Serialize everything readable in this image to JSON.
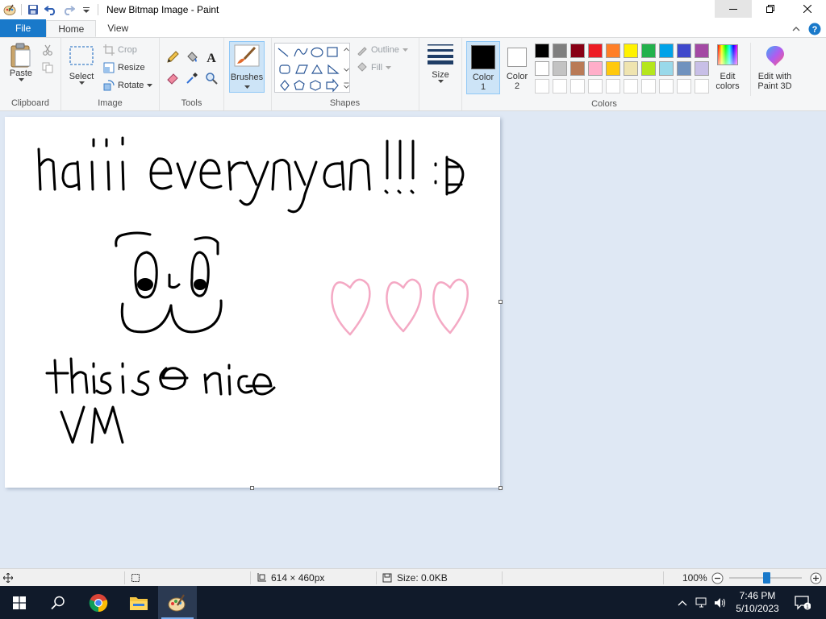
{
  "window": {
    "title": "New Bitmap Image - Paint"
  },
  "tabs": {
    "file": "File",
    "home": "Home",
    "view": "View"
  },
  "ribbon": {
    "clipboard": {
      "paste": "Paste",
      "label": "Clipboard"
    },
    "image": {
      "select": "Select",
      "crop": "Crop",
      "resize": "Resize",
      "rotate": "Rotate",
      "label": "Image"
    },
    "tools": {
      "label": "Tools"
    },
    "brushes": {
      "label": "Brushes"
    },
    "shapes": {
      "outline": "Outline",
      "fill": "Fill",
      "label": "Shapes"
    },
    "size": {
      "label": "Size"
    },
    "colors": {
      "color1": "Color",
      "color1_num": "1",
      "color2": "Color",
      "color2_num": "2",
      "edit_colors_1": "Edit",
      "edit_colors_2": "colors",
      "edit_paint3d_1": "Edit with",
      "edit_paint3d_2": "Paint 3D",
      "label": "Colors",
      "color1_value": "#000000",
      "color2_value": "#ffffff",
      "palette_row1": [
        "#000000",
        "#7f7f7f",
        "#880015",
        "#ed1c24",
        "#ff7f27",
        "#fff200",
        "#22b14c",
        "#00a2e8",
        "#3f48cc",
        "#a349a4"
      ],
      "palette_row2": [
        "#ffffff",
        "#c3c3c3",
        "#b97a57",
        "#ffaec9",
        "#ffc90e",
        "#efe4b0",
        "#b5e61d",
        "#99d9ea",
        "#7092be",
        "#c8bfe7"
      ],
      "palette_row3": [
        "#ffffff",
        "#ffffff",
        "#ffffff",
        "#ffffff",
        "#ffffff",
        "#ffffff",
        "#ffffff",
        "#ffffff",
        "#ffffff",
        "#ffffff"
      ]
    }
  },
  "status": {
    "dimensions": "614 × 460px",
    "size": "Size: 0.0KB",
    "zoom": "100%"
  },
  "taskbar": {
    "time": "7:46 PM",
    "date": "5/10/2023"
  }
}
